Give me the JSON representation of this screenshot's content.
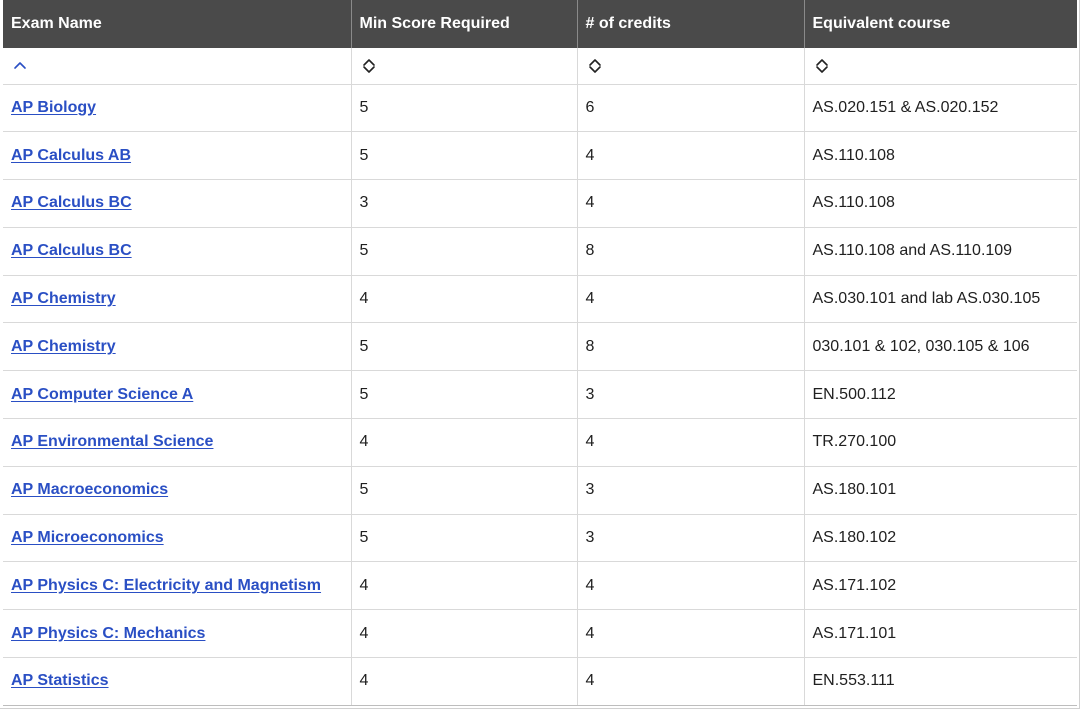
{
  "table": {
    "headers": [
      "Exam Name",
      "Min Score Required",
      "# of credits",
      "Equivalent course"
    ],
    "sort_icons": [
      "sort-ascending-icon",
      "sort-both-icon",
      "sort-both-icon",
      "sort-both-icon"
    ],
    "rows": [
      {
        "exam": "AP Biology",
        "min_score": "5",
        "credits": "6",
        "course": "AS.020.151 & AS.020.152"
      },
      {
        "exam": "AP Calculus AB",
        "min_score": "5",
        "credits": "4",
        "course": "AS.110.108"
      },
      {
        "exam": "AP Calculus BC",
        "min_score": "3",
        "credits": "4",
        "course": "AS.110.108"
      },
      {
        "exam": "AP Calculus BC",
        "min_score": "5",
        "credits": "8",
        "course": "AS.110.108 and AS.110.109"
      },
      {
        "exam": "AP Chemistry",
        "min_score": "4",
        "credits": "4",
        "course": "AS.030.101 and lab AS.030.105"
      },
      {
        "exam": "AP Chemistry",
        "min_score": "5",
        "credits": "8",
        "course": "030.101 & 102, 030.105 & 106"
      },
      {
        "exam": "AP Computer Science A",
        "min_score": "5",
        "credits": "3",
        "course": "EN.500.112"
      },
      {
        "exam": "AP Environmental Science",
        "min_score": "4",
        "credits": "4",
        "course": "TR.270.100"
      },
      {
        "exam": "AP Macroeconomics",
        "min_score": "5",
        "credits": "3",
        "course": "AS.180.101"
      },
      {
        "exam": "AP Microeconomics",
        "min_score": "5",
        "credits": "3",
        "course": "AS.180.102"
      },
      {
        "exam": "AP Physics C: Electricity and Magnetism",
        "min_score": "4",
        "credits": "4",
        "course": "AS.171.102"
      },
      {
        "exam": "AP Physics C: Mechanics",
        "min_score": "4",
        "credits": "4",
        "course": "AS.171.101"
      },
      {
        "exam": "AP Statistics",
        "min_score": "4",
        "credits": "4",
        "course": "EN.553.111"
      }
    ]
  },
  "colors": {
    "header_bg": "#4a4a4a",
    "header_text": "#ffffff",
    "link": "#2a4fc4",
    "sort_active": "#2a4fc4",
    "grid": "#d9d9d9"
  }
}
